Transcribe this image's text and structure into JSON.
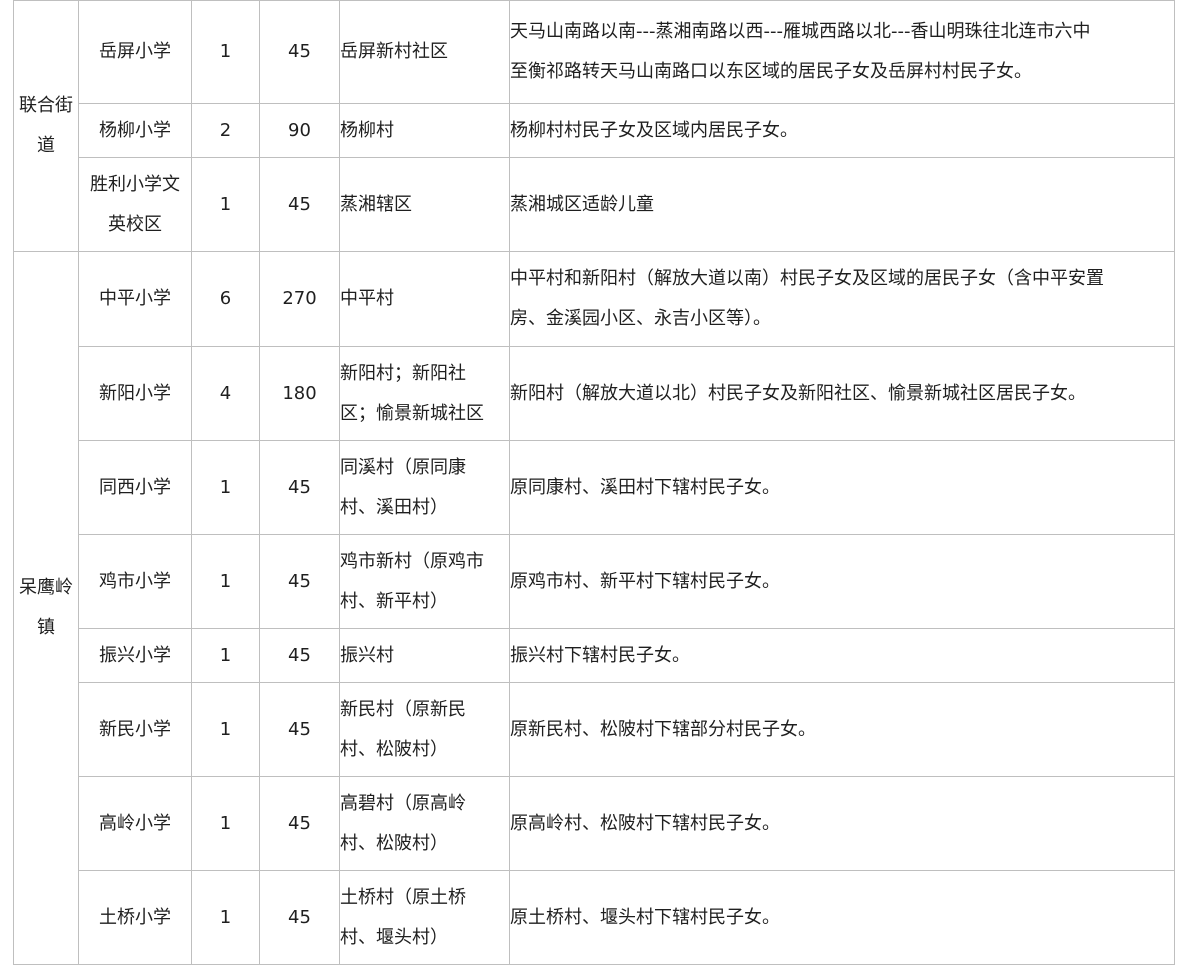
{
  "table": {
    "groups": [
      {
        "district": "联合街道",
        "district_lines": [
          "联合街",
          "道"
        ],
        "rows": [
          {
            "school_lines": [
              "岳屏小学"
            ],
            "classes": "1",
            "enroll": "45",
            "area_lines": [
              "岳屏新村社区"
            ],
            "desc_lines": [
              "天马山南路以南---蒸湘南路以西---雁城西路以北---香山明珠往北连市六中",
              "至衡祁路转天马山南路口以东区域的居民子女及岳屏村村民子女。"
            ]
          },
          {
            "school_lines": [
              "杨柳小学"
            ],
            "classes": "2",
            "enroll": "90",
            "area_lines": [
              "杨柳村"
            ],
            "desc_lines": [
              "杨柳村村民子女及区域内居民子女。"
            ]
          },
          {
            "school_lines": [
              "胜利小学文",
              "英校区"
            ],
            "classes": "1",
            "enroll": "45",
            "area_lines": [
              "蒸湘辖区"
            ],
            "desc_lines": [
              "蒸湘城区适龄儿童"
            ]
          }
        ]
      },
      {
        "district": "呆鹰岭镇",
        "district_lines": [
          "呆鹰岭",
          "镇"
        ],
        "rows": [
          {
            "school_lines": [
              "中平小学"
            ],
            "classes": "6",
            "enroll": "270",
            "area_lines": [
              "中平村"
            ],
            "desc_lines": [
              "中平村和新阳村（解放大道以南）村民子女及区域的居民子女（含中平安置",
              "房、金溪园小区、永吉小区等）。"
            ]
          },
          {
            "school_lines": [
              "新阳小学"
            ],
            "classes": "4",
            "enroll": "180",
            "area_lines": [
              "新阳村；新阳社",
              "区；愉景新城社区"
            ],
            "desc_lines": [
              "新阳村（解放大道以北）村民子女及新阳社区、愉景新城社区居民子女。"
            ]
          },
          {
            "school_lines": [
              "同西小学"
            ],
            "classes": "1",
            "enroll": "45",
            "area_lines": [
              "同溪村（原同康",
              "村、溪田村）"
            ],
            "desc_lines": [
              "原同康村、溪田村下辖村民子女。"
            ]
          },
          {
            "school_lines": [
              "鸡市小学"
            ],
            "classes": "1",
            "enroll": "45",
            "area_lines": [
              "鸡市新村（原鸡市",
              "村、新平村）"
            ],
            "desc_lines": [
              "原鸡市村、新平村下辖村民子女。"
            ]
          },
          {
            "school_lines": [
              "振兴小学"
            ],
            "classes": "1",
            "enroll": "45",
            "area_lines": [
              "振兴村"
            ],
            "desc_lines": [
              "振兴村下辖村民子女。"
            ]
          },
          {
            "school_lines": [
              "新民小学"
            ],
            "classes": "1",
            "enroll": "45",
            "area_lines": [
              "新民村（原新民",
              "村、松陂村）"
            ],
            "desc_lines": [
              "原新民村、松陂村下辖部分村民子女。"
            ]
          },
          {
            "school_lines": [
              "高岭小学"
            ],
            "classes": "1",
            "enroll": "45",
            "area_lines": [
              "高碧村（原高岭",
              "村、松陂村）"
            ],
            "desc_lines": [
              "原高岭村、松陂村下辖村民子女。"
            ]
          },
          {
            "school_lines": [
              "土桥小学"
            ],
            "classes": "1",
            "enroll": "45",
            "area_lines": [
              "土桥村（原土桥",
              "村、堰头村）"
            ],
            "desc_lines": [
              "原土桥村、堰头村下辖村民子女。"
            ]
          }
        ]
      }
    ]
  }
}
